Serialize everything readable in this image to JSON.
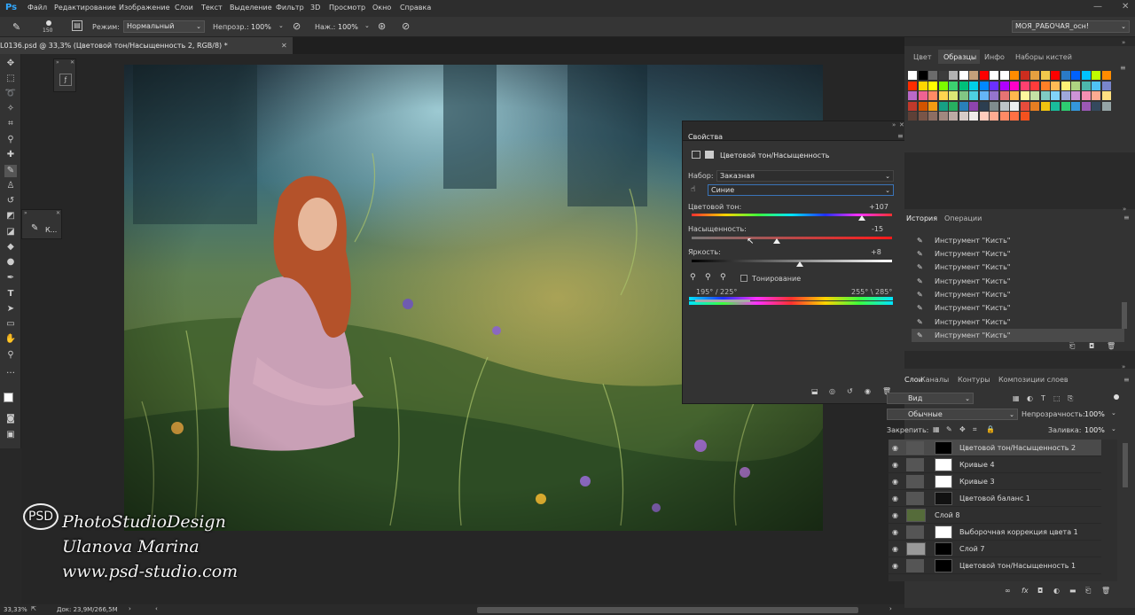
{
  "app": {
    "logo": "Ps"
  },
  "menu": [
    "Файл",
    "Редактирование",
    "Изображение",
    "Слои",
    "Текст",
    "Выделение",
    "Фильтр",
    "3D",
    "Просмотр",
    "Окно",
    "Справка"
  ],
  "options": {
    "brush_size": "150",
    "mode_label": "Режим:",
    "mode_value": "Нормальный",
    "opacity_label": "Непрозр.:",
    "opacity_value": "100%",
    "pressure_label": "Наж.:",
    "pressure_value": "100%",
    "workspace": "МОЯ_РАБОЧАЯ_осн!"
  },
  "document_tab": {
    "title": "L0136.psd @ 33,3% (Цветовой тон/Насыщенность 2, RGB/8) *"
  },
  "mini_panel": {
    "label": "К..."
  },
  "properties": {
    "panel_title": "Свойства",
    "adjustment_name": "Цветовой тон/Насыщенность",
    "preset_label": "Набор:",
    "preset_value": "Заказная",
    "channel_value": "Синие",
    "hue_label": "Цветовой тон:",
    "hue_value": "+107",
    "hue_fraction": 0.85,
    "saturation_label": "Насыщенность:",
    "saturation_value": "-15",
    "saturation_fraction": 0.425,
    "lightness_label": "Яркость:",
    "lightness_value": "+8",
    "lightness_fraction": 0.54,
    "colorize_label": "Тонирование",
    "range_left": "195° / 225°",
    "range_right": "255° \\ 285°"
  },
  "swatches_panel": {
    "tabs": [
      "Цвет",
      "Образцы",
      "Инфо",
      "Наборы кистей"
    ],
    "active_tab": "Образцы",
    "colors": [
      "#ffffff",
      "#000000",
      "#6b6b6b",
      "#3c3c3c",
      "#b3b3b3",
      "#ffffff",
      "#c4a07a",
      "#ff0000",
      "#ffffff",
      "#ffffff",
      "#ff8c00",
      "#cc2d1f",
      "#e6a040",
      "#f2c94c",
      "#ff0000",
      "#2a7bc7",
      "#0061ff",
      "#00c3ff",
      "#bfff00",
      "#ff8c00",
      "#ff2d00",
      "#ffd700",
      "#ffff00",
      "#7cfc00",
      "#3cd070",
      "#00c07a",
      "#00cfe8",
      "#0088ff",
      "#6a30ff",
      "#b000ff",
      "#ff00c8",
      "#ff4070",
      "#ff3b3b",
      "#ff7f27",
      "#ffbb55",
      "#fff176",
      "#aed581",
      "#4db6ac",
      "#4fc3f7",
      "#7986cb",
      "#ba68c8",
      "#f06292",
      "#ff8a65",
      "#ffd54f",
      "#dce775",
      "#81c784",
      "#4dd0e1",
      "#64b5f6",
      "#9575cd",
      "#e57373",
      "#ffb74d",
      "#fff59d",
      "#c5e1a5",
      "#80cbc4",
      "#81d4fa",
      "#9fa8da",
      "#ce93d8",
      "#f48fb1",
      "#ffab91",
      "#ffe082",
      "#c0392b",
      "#d35400",
      "#f39c12",
      "#16a085",
      "#27ae60",
      "#2980b9",
      "#8e44ad",
      "#2c3e50",
      "#7f8c8d",
      "#bdc3c7",
      "#ecf0f1",
      "#e74c3c",
      "#e67e22",
      "#f1c40f",
      "#1abc9c",
      "#2ecc71",
      "#3498db",
      "#9b59b6",
      "#34495e",
      "#95a5a6",
      "#5d4037",
      "#795548",
      "#8d6e63",
      "#a1887f",
      "#bcaaa4",
      "#d7ccc8",
      "#efebe9",
      "#ffccbc",
      "#ffab91",
      "#ff8a65",
      "#ff7043",
      "#f4511e"
    ]
  },
  "history_panel": {
    "tabs": [
      "История",
      "Операции"
    ],
    "items": [
      "Инструмент \"Кисть\"",
      "Инструмент \"Кисть\"",
      "Инструмент \"Кисть\"",
      "Инструмент \"Кисть\"",
      "Инструмент \"Кисть\"",
      "Инструмент \"Кисть\"",
      "Инструмент \"Кисть\"",
      "Инструмент \"Кисть\""
    ]
  },
  "layers_panel": {
    "tabs": [
      "Слои",
      "Каналы",
      "Контуры",
      "Композиции слоев"
    ],
    "filter_kind": "Вид",
    "blend_mode": "Обычные",
    "opacity_label": "Непрозрачность:",
    "opacity_value": "100%",
    "lock_label": "Закрепить:",
    "fill_label": "Заливка:",
    "fill_value": "100%",
    "layers": [
      {
        "name": "Цветовой тон/Насыщенность 2",
        "selected": true
      },
      {
        "name": "Кривые 4",
        "selected": false
      },
      {
        "name": "Кривые 3",
        "selected": false
      },
      {
        "name": "Цветовой баланс 1",
        "selected": false
      },
      {
        "name": "Слой 8",
        "selected": false
      },
      {
        "name": "Выборочная коррекция цвета 1",
        "selected": false
      },
      {
        "name": "Слой 7",
        "selected": false
      },
      {
        "name": "Цветовой тон/Насыщенность 1",
        "selected": false
      }
    ]
  },
  "statusbar": {
    "zoom": "33,33%",
    "doc": "Док: 23,9M/266,5M"
  },
  "watermark": {
    "logo": "PSD",
    "line1": "PhotoStudioDesign",
    "line2": "Ulanova Marina",
    "line3": "www.psd-studio.com"
  }
}
